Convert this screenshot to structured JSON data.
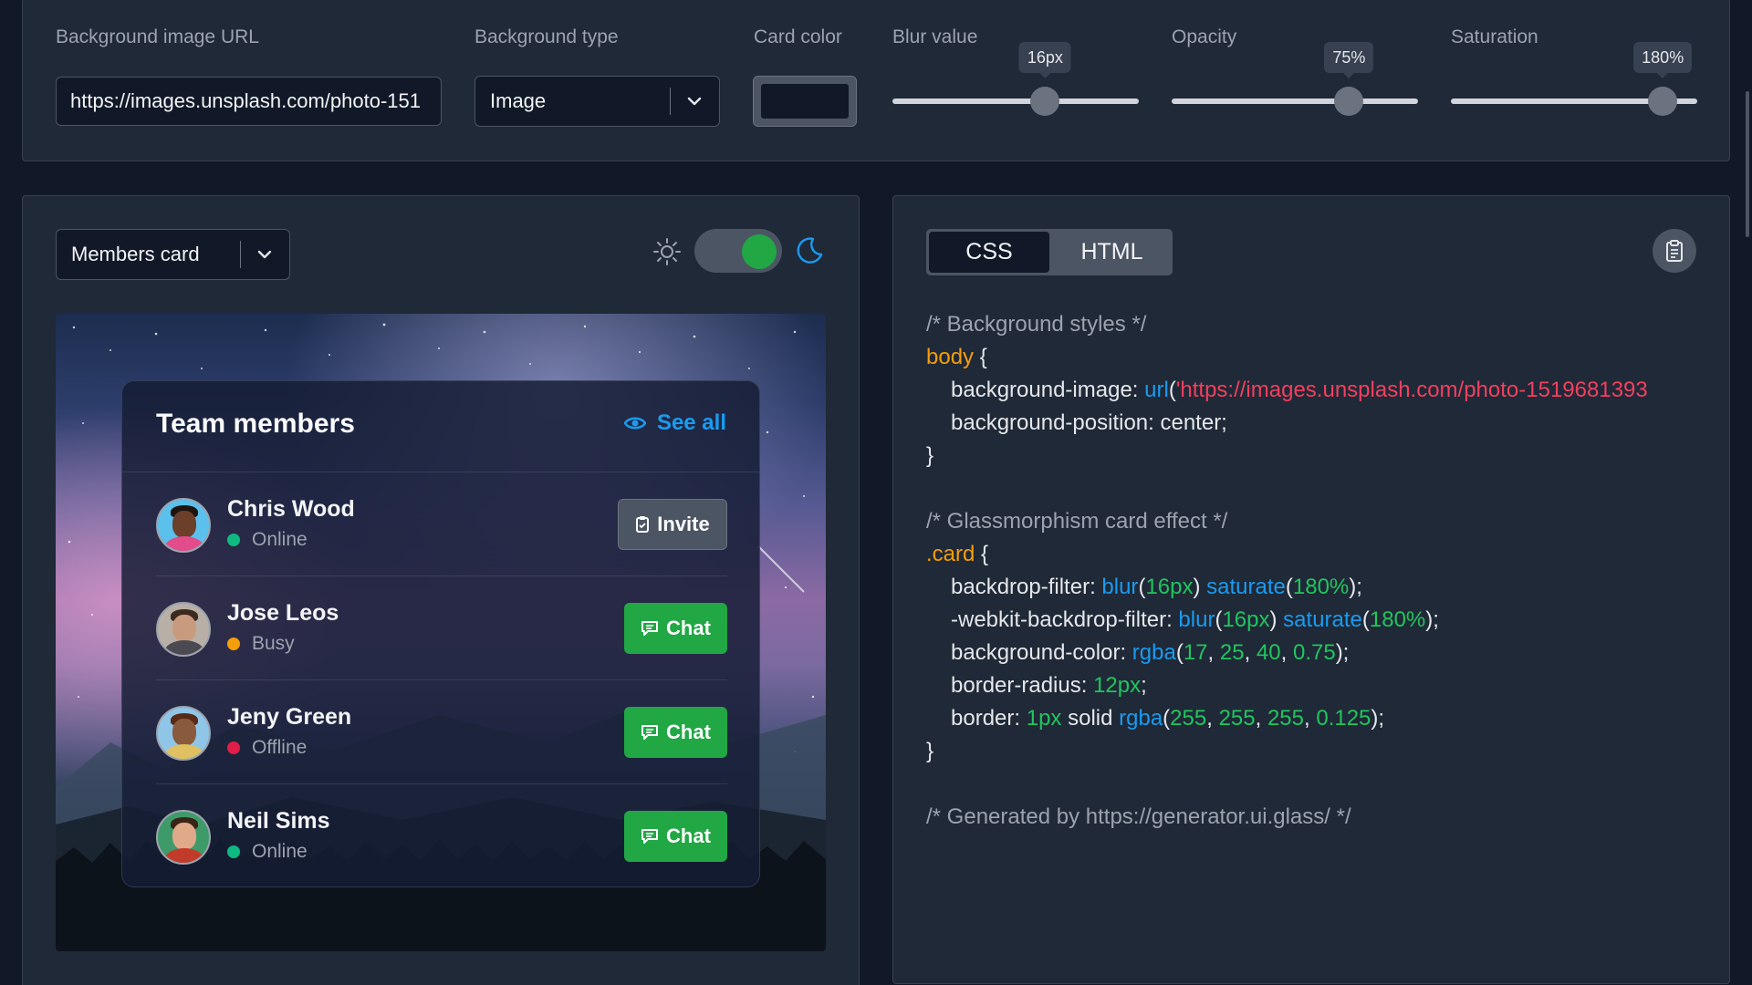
{
  "settings": {
    "bg_url": {
      "label": "Background image URL",
      "value": "https://images.unsplash.com/photo-151"
    },
    "bg_type": {
      "label": "Background type",
      "value": "Image"
    },
    "card_color": {
      "label": "Card color",
      "color": "#111928"
    },
    "blur": {
      "label": "Blur value",
      "value_text": "16px",
      "value": 16,
      "fraction": 0.62
    },
    "opacity": {
      "label": "Opacity",
      "value_text": "75%",
      "value": 75,
      "fraction": 0.72
    },
    "saturation": {
      "label": "Saturation",
      "value_text": "180%",
      "value": 180,
      "fraction": 0.86
    }
  },
  "preview": {
    "card_select": "Members card",
    "theme_toggle_on": true,
    "card": {
      "title": "Team members",
      "see_all": "See all",
      "members": [
        {
          "name": "Chris Wood",
          "status": "Online",
          "status_color": "#10b981",
          "action": "Invite"
        },
        {
          "name": "Jose Leos",
          "status": "Busy",
          "status_color": "#f59e0b",
          "action": "Chat"
        },
        {
          "name": "Jeny Green",
          "status": "Offline",
          "status_color": "#e11d48",
          "action": "Chat"
        },
        {
          "name": "Neil Sims",
          "status": "Online",
          "status_color": "#10b981",
          "action": "Chat"
        }
      ]
    }
  },
  "code": {
    "tabs": [
      "CSS",
      "HTML"
    ],
    "active_tab": "CSS",
    "lines": [
      {
        "indent": 0,
        "tokens": [
          {
            "t": "/* Background styles */",
            "c": "c-comment"
          }
        ]
      },
      {
        "indent": 0,
        "tokens": [
          {
            "t": "body",
            "c": "c-sel"
          },
          {
            "t": " {",
            "c": "c-plain"
          }
        ]
      },
      {
        "indent": 1,
        "tokens": [
          {
            "t": "background-image",
            "c": "c-prop"
          },
          {
            "t": ": ",
            "c": "c-plain"
          },
          {
            "t": "url",
            "c": "c-fn"
          },
          {
            "t": "(",
            "c": "c-plain"
          },
          {
            "t": "'https://images.unsplash.com/photo-1519681393",
            "c": "c-str"
          }
        ]
      },
      {
        "indent": 1,
        "tokens": [
          {
            "t": "background-position",
            "c": "c-prop"
          },
          {
            "t": ": center;",
            "c": "c-plain"
          }
        ]
      },
      {
        "indent": 0,
        "tokens": [
          {
            "t": "}",
            "c": "c-plain"
          }
        ]
      },
      {
        "indent": 0,
        "tokens": []
      },
      {
        "indent": 0,
        "tokens": [
          {
            "t": "/* Glassmorphism card effect */",
            "c": "c-comment"
          }
        ]
      },
      {
        "indent": 0,
        "tokens": [
          {
            "t": ".card",
            "c": "c-sel"
          },
          {
            "t": " {",
            "c": "c-plain"
          }
        ]
      },
      {
        "indent": 1,
        "tokens": [
          {
            "t": "backdrop-filter",
            "c": "c-prop"
          },
          {
            "t": ": ",
            "c": "c-plain"
          },
          {
            "t": "blur",
            "c": "c-fn"
          },
          {
            "t": "(",
            "c": "c-plain"
          },
          {
            "t": "16px",
            "c": "c-num"
          },
          {
            "t": ") ",
            "c": "c-plain"
          },
          {
            "t": "saturate",
            "c": "c-fn"
          },
          {
            "t": "(",
            "c": "c-plain"
          },
          {
            "t": "180%",
            "c": "c-num"
          },
          {
            "t": ");",
            "c": "c-plain"
          }
        ]
      },
      {
        "indent": 1,
        "tokens": [
          {
            "t": "-webkit-backdrop-filter",
            "c": "c-prop"
          },
          {
            "t": ": ",
            "c": "c-plain"
          },
          {
            "t": "blur",
            "c": "c-fn"
          },
          {
            "t": "(",
            "c": "c-plain"
          },
          {
            "t": "16px",
            "c": "c-num"
          },
          {
            "t": ") ",
            "c": "c-plain"
          },
          {
            "t": "saturate",
            "c": "c-fn"
          },
          {
            "t": "(",
            "c": "c-plain"
          },
          {
            "t": "180%",
            "c": "c-num"
          },
          {
            "t": ");",
            "c": "c-plain"
          }
        ]
      },
      {
        "indent": 1,
        "tokens": [
          {
            "t": "background-color",
            "c": "c-prop"
          },
          {
            "t": ": ",
            "c": "c-plain"
          },
          {
            "t": "rgba",
            "c": "c-fn"
          },
          {
            "t": "(",
            "c": "c-plain"
          },
          {
            "t": "17",
            "c": "c-num"
          },
          {
            "t": ", ",
            "c": "c-plain"
          },
          {
            "t": "25",
            "c": "c-num"
          },
          {
            "t": ", ",
            "c": "c-plain"
          },
          {
            "t": "40",
            "c": "c-num"
          },
          {
            "t": ", ",
            "c": "c-plain"
          },
          {
            "t": "0.75",
            "c": "c-num"
          },
          {
            "t": ");",
            "c": "c-plain"
          }
        ]
      },
      {
        "indent": 1,
        "tokens": [
          {
            "t": "border-radius",
            "c": "c-prop"
          },
          {
            "t": ": ",
            "c": "c-plain"
          },
          {
            "t": "12px",
            "c": "c-num"
          },
          {
            "t": ";",
            "c": "c-plain"
          }
        ]
      },
      {
        "indent": 1,
        "tokens": [
          {
            "t": "border",
            "c": "c-prop"
          },
          {
            "t": ": ",
            "c": "c-plain"
          },
          {
            "t": "1px",
            "c": "c-num"
          },
          {
            "t": " solid ",
            "c": "c-plain"
          },
          {
            "t": "rgba",
            "c": "c-fn"
          },
          {
            "t": "(",
            "c": "c-plain"
          },
          {
            "t": "255",
            "c": "c-num"
          },
          {
            "t": ", ",
            "c": "c-plain"
          },
          {
            "t": "255",
            "c": "c-num"
          },
          {
            "t": ", ",
            "c": "c-plain"
          },
          {
            "t": "255",
            "c": "c-num"
          },
          {
            "t": ", ",
            "c": "c-plain"
          },
          {
            "t": "0.125",
            "c": "c-num"
          },
          {
            "t": ");",
            "c": "c-plain"
          }
        ]
      },
      {
        "indent": 0,
        "tokens": [
          {
            "t": "}",
            "c": "c-plain"
          }
        ]
      },
      {
        "indent": 0,
        "tokens": []
      },
      {
        "indent": 0,
        "tokens": [
          {
            "t": "/* Generated by https://generator.ui.glass/ */",
            "c": "c-comment"
          }
        ]
      }
    ]
  }
}
